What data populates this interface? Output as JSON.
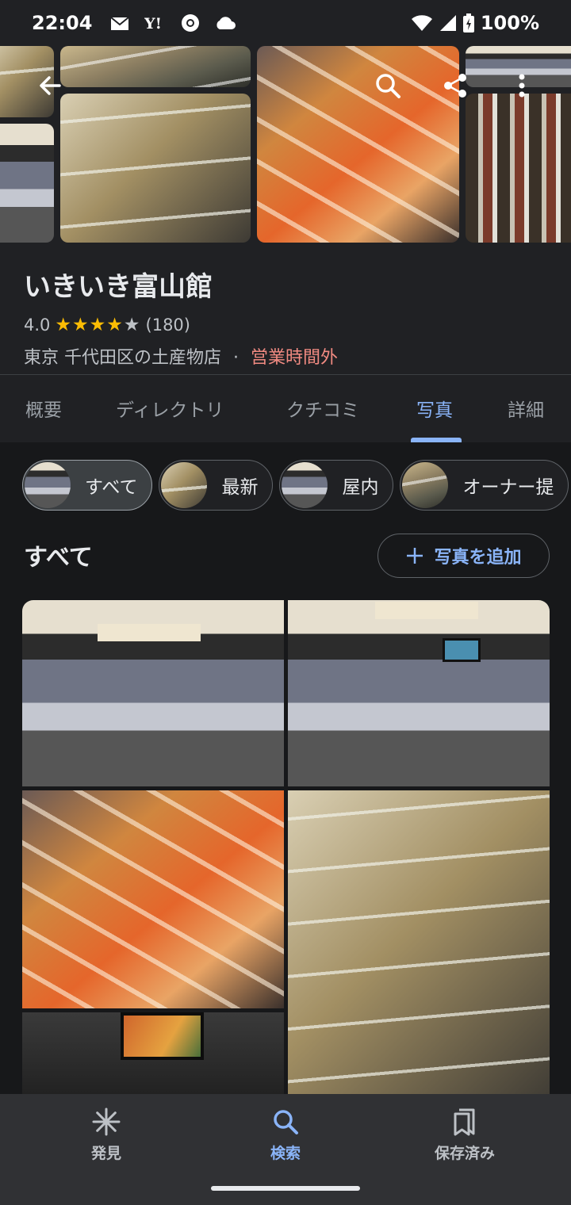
{
  "status_bar": {
    "time": "22:04",
    "battery": "100%",
    "notification_icons": [
      "mail-icon",
      "yahoo-icon",
      "chrome-icon",
      "cloud-icon"
    ]
  },
  "place": {
    "name": "いきいき富山館",
    "rating": "4.0",
    "review_count": "(180)",
    "category": "東京 千代田区の土産物店",
    "separator": "·",
    "status": "営業時間外"
  },
  "tabs": [
    {
      "label": "概要",
      "active": false
    },
    {
      "label": "ディレクトリ",
      "active": false
    },
    {
      "label": "クチコミ",
      "active": false
    },
    {
      "label": "写真",
      "active": true
    },
    {
      "label": "詳細",
      "active": false
    }
  ],
  "photo_filters": [
    {
      "label": "すべて",
      "selected": true
    },
    {
      "label": "最新",
      "selected": false
    },
    {
      "label": "屋内",
      "selected": false
    },
    {
      "label": "オーナー提",
      "selected": false
    }
  ],
  "photos_section": {
    "title": "すべて",
    "add_button": "写真を追加"
  },
  "bottom_nav": [
    {
      "label": "発見",
      "icon": "asterisk-icon",
      "active": false
    },
    {
      "label": "検索",
      "icon": "search-icon",
      "active": true
    },
    {
      "label": "保存済み",
      "icon": "bookmarks-icon",
      "active": false
    }
  ],
  "colors": {
    "accent": "#8ab4f8",
    "star": "#fbbc04",
    "closed": "#f28b82",
    "background": "#202124"
  }
}
